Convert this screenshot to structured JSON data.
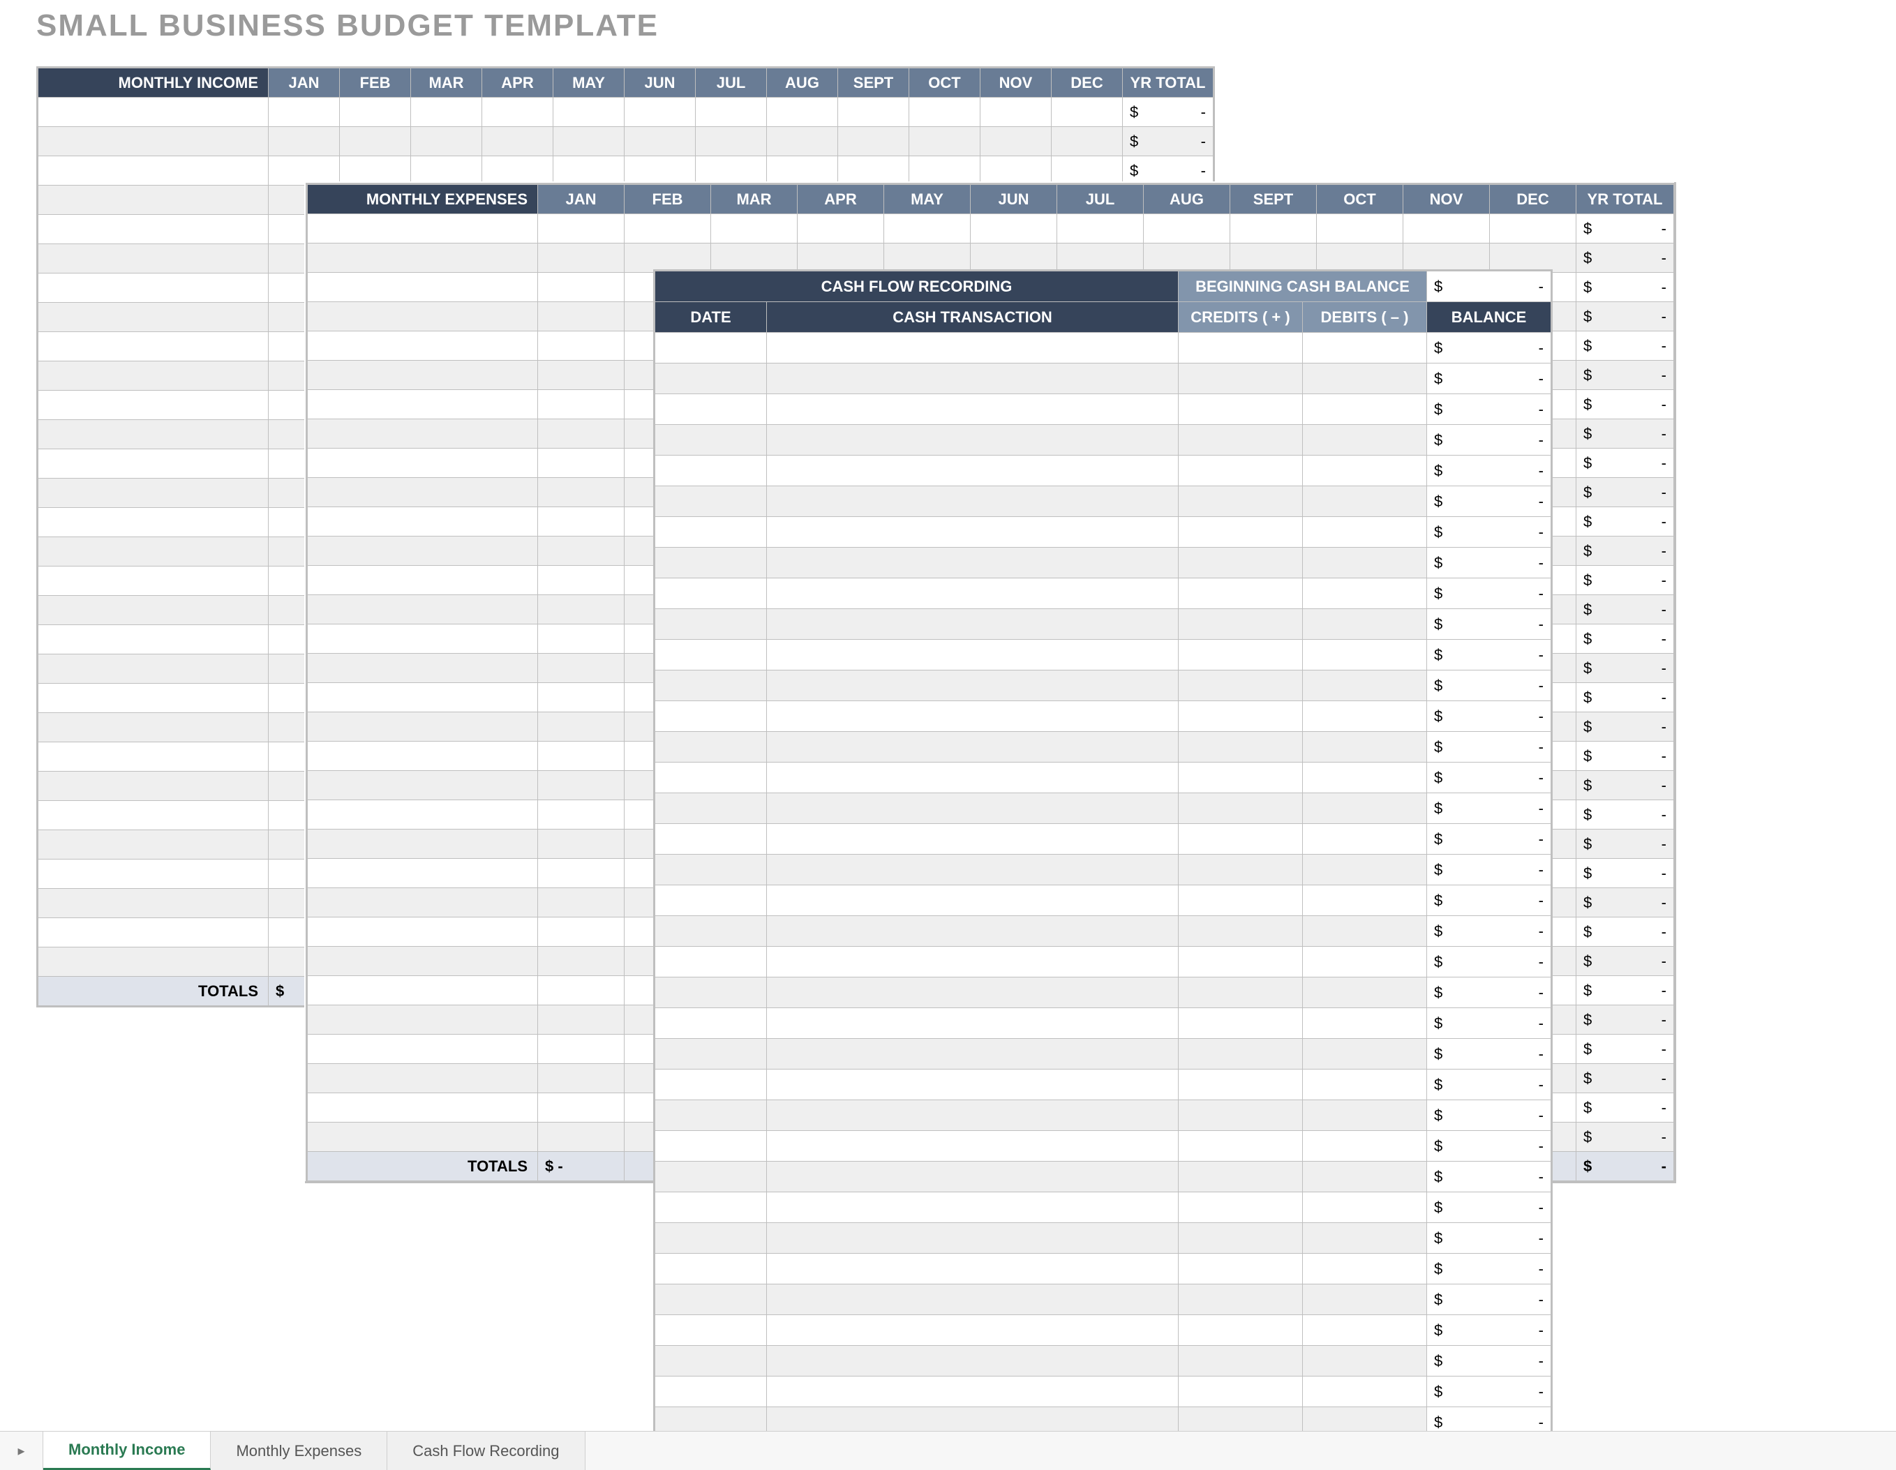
{
  "title": "SMALL BUSINESS BUDGET TEMPLATE",
  "months": [
    "JAN",
    "FEB",
    "MAR",
    "APR",
    "MAY",
    "JUN",
    "JUL",
    "AUG",
    "SEPT",
    "OCT",
    "NOV",
    "DEC"
  ],
  "yrTotalLabel": "YR TOTAL",
  "totalsLabel": "TOTALS",
  "currencySymbol": "$",
  "dash": "-",
  "income": {
    "header": "MONTHLY INCOME",
    "rows": 30,
    "totalsFirstCell": "$"
  },
  "expenses": {
    "header": "MONTHLY EXPENSES",
    "rows": 32,
    "totalsFirstCell": "$          -"
  },
  "cashflow": {
    "title": "CASH FLOW RECORDING",
    "beginningLabel": "BEGINNING CASH BALANCE",
    "beginningBalance": {
      "cur": "$",
      "dash": "-"
    },
    "cols": {
      "date": "DATE",
      "transaction": "CASH TRANSACTION",
      "credits": "CREDITS ( + )",
      "debits": "DEBITS ( – )",
      "balance": "BALANCE"
    },
    "rows": 37
  },
  "tabs": {
    "active": "Monthly Income",
    "items": [
      "Monthly Income",
      "Monthly Expenses",
      "Cash Flow Recording"
    ]
  }
}
